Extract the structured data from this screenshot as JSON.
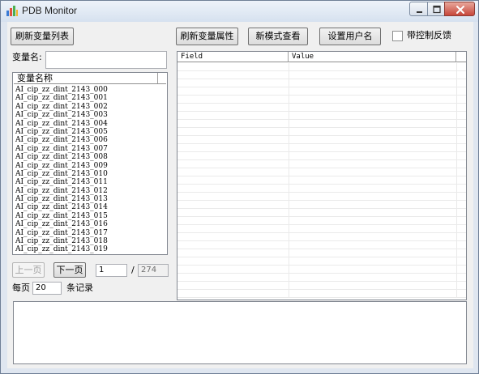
{
  "window": {
    "title": "PDB Monitor"
  },
  "toolbar": {
    "refresh_list": "刷新变量列表",
    "refresh_attrs": "刷新变量属性",
    "new_mode_view": "新模式查看",
    "set_username": "设置用户名",
    "feedback_checkbox_label": "带控制反馈",
    "feedback_checked": false
  },
  "filter": {
    "label": "变量名:",
    "value": ""
  },
  "variable_list": {
    "header": "变量名称",
    "items": [
      "AI_cip_zz_dint_2143_000",
      "AI_cip_zz_dint_2143_001",
      "AI_cip_zz_dint_2143_002",
      "AI_cip_zz_dint_2143_003",
      "AI_cip_zz_dint_2143_004",
      "AI_cip_zz_dint_2143_005",
      "AI_cip_zz_dint_2143_006",
      "AI_cip_zz_dint_2143_007",
      "AI_cip_zz_dint_2143_008",
      "AI_cip_zz_dint_2143_009",
      "AI_cip_zz_dint_2143_010",
      "AI_cip_zz_dint_2143_011",
      "AI_cip_zz_dint_2143_012",
      "AI_cip_zz_dint_2143_013",
      "AI_cip_zz_dint_2143_014",
      "AI_cip_zz_dint_2143_015",
      "AI_cip_zz_dint_2143_016",
      "AI_cip_zz_dint_2143_017",
      "AI_cip_zz_dint_2143_018",
      "AI_cip_zz_dint_2143_019"
    ]
  },
  "pagination": {
    "prev_label": "上一页",
    "next_label": "下一页",
    "current_page": "1",
    "separator": "/",
    "total_pages": "274",
    "per_page_label": "每页",
    "per_page_value": "20",
    "records_label": "条记录"
  },
  "properties_grid": {
    "columns": [
      "Field",
      "Value"
    ]
  },
  "output": {
    "text": ""
  }
}
